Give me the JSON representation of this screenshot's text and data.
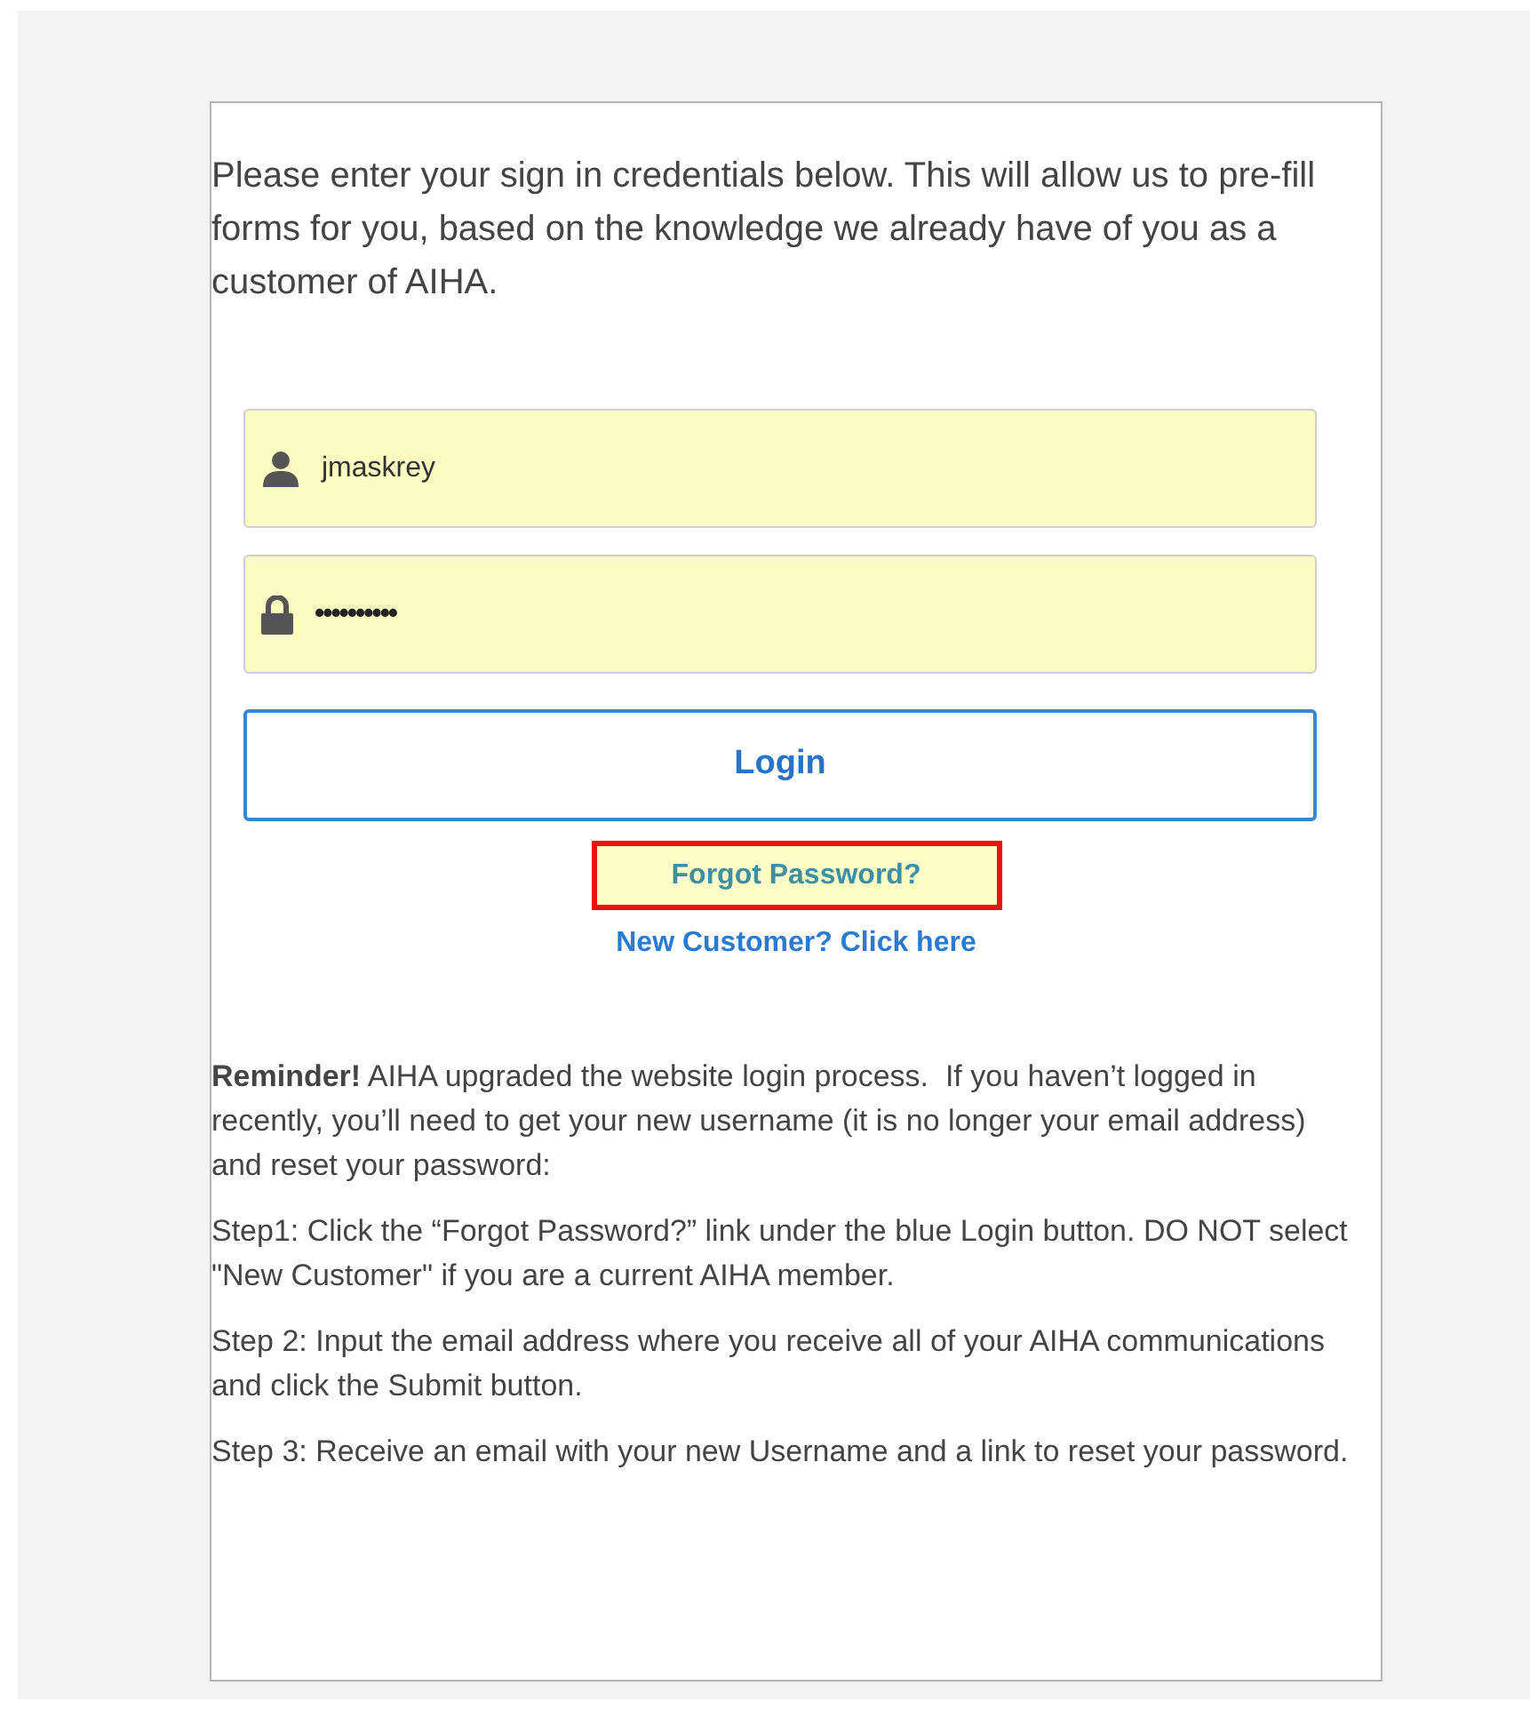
{
  "intro": "Please enter your sign in credentials below. This will allow us to pre-fill forms for you, based on the knowledge we already have of you as a customer of AIHA.",
  "fields": [
    {
      "kind": "username",
      "value": "jmaskrey"
    },
    {
      "kind": "password",
      "value": "••••••••••"
    }
  ],
  "login_button": "Login",
  "links": [
    {
      "label": "Forgot Password?",
      "highlighted": true
    },
    {
      "label": "New Customer? Click here",
      "highlighted": false
    }
  ],
  "paragraphs": [
    "**Reminder!** AIHA upgraded the website login process.  If you haven’t logged in recently, you’ll need to get your new username (it is no longer your email address) and reset your password:",
    "Step1: Click the “Forgot Password?” link under the blue Login button. DO NOT select \"New Customer\" if you are a current AIHA member.",
    "Step 2: Input the email address where you receive all of your AIHA communications and click the Submit button.",
    "Step 3: Receive an email with your new Username and a link to reset your password."
  ]
}
